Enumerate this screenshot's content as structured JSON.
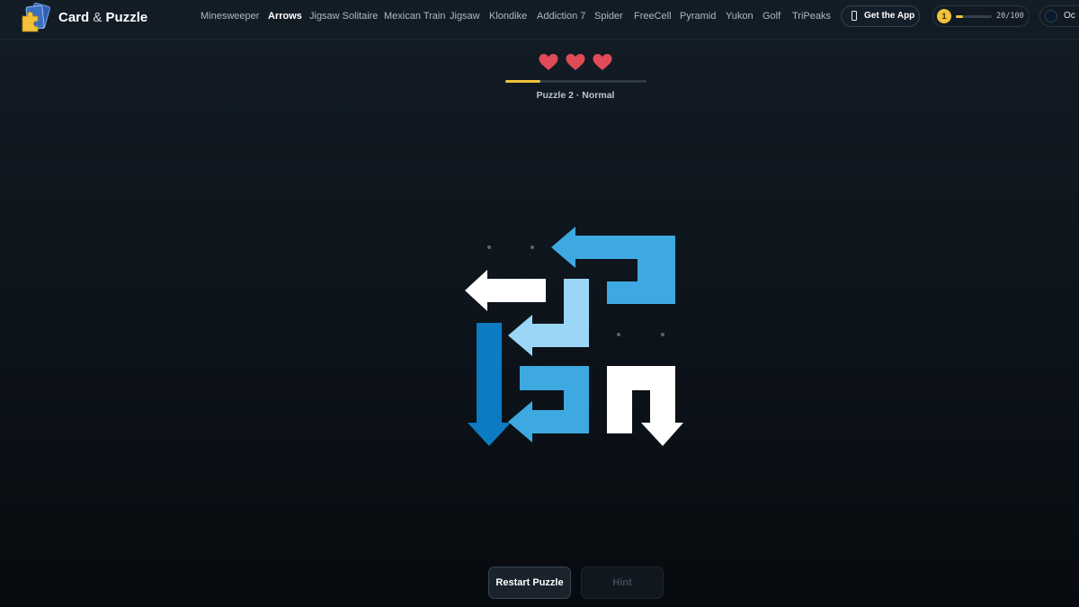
{
  "header": {
    "brand_name": "Card",
    "brand_amp": "&",
    "brand_suffix": "Puzzle",
    "nav": [
      {
        "label": "Minesweeper",
        "active": false
      },
      {
        "label": "Arrows",
        "active": true
      },
      {
        "label": "Jigsaw Solitaire",
        "active": false
      },
      {
        "label": "Mexican Train",
        "active": false
      },
      {
        "label": "Jigsaw",
        "active": false
      },
      {
        "label": "Klondike",
        "active": false
      },
      {
        "label": "Addiction 7",
        "active": false
      },
      {
        "label": "Spider",
        "active": false
      },
      {
        "label": "FreeCell",
        "active": false
      },
      {
        "label": "Pyramid",
        "active": false
      },
      {
        "label": "Yukon",
        "active": false
      },
      {
        "label": "Golf",
        "active": false
      },
      {
        "label": "TriPeaks",
        "active": false
      }
    ],
    "get_app_label": "Get the App",
    "get_app_icon": "phone-icon",
    "level": "1",
    "xp_current": 20,
    "xp_max": 100,
    "xp_text": "20/100",
    "theme_label": "Oc"
  },
  "status": {
    "lives": 3,
    "heart_icon": "heart-icon",
    "heart_color": "#e04b57",
    "puzzle_progress": 0.25,
    "puzzle_label": "Puzzle 2 · Normal"
  },
  "board": {
    "grid_size": 5,
    "arrows": [
      {
        "name": "arrow-top-right",
        "color": "#3ea9e0",
        "points_to": "left"
      },
      {
        "name": "arrow-top-left",
        "color": "#ffffff",
        "points_to": "left"
      },
      {
        "name": "arrow-middle",
        "color": "#9bd6f7",
        "points_to": "left"
      },
      {
        "name": "arrow-left-column",
        "color": "#0c7bc4",
        "points_to": "down"
      },
      {
        "name": "arrow-bottom-middle",
        "color": "#3ea9e0",
        "points_to": "left"
      },
      {
        "name": "arrow-bottom-right",
        "color": "#ffffff",
        "points_to": "down"
      }
    ]
  },
  "actions": {
    "restart_label": "Restart Puzzle",
    "hint_label": "Hint",
    "hint_enabled": false
  },
  "colors": {
    "accent": "#f0c23a",
    "background": "#0d141b"
  }
}
